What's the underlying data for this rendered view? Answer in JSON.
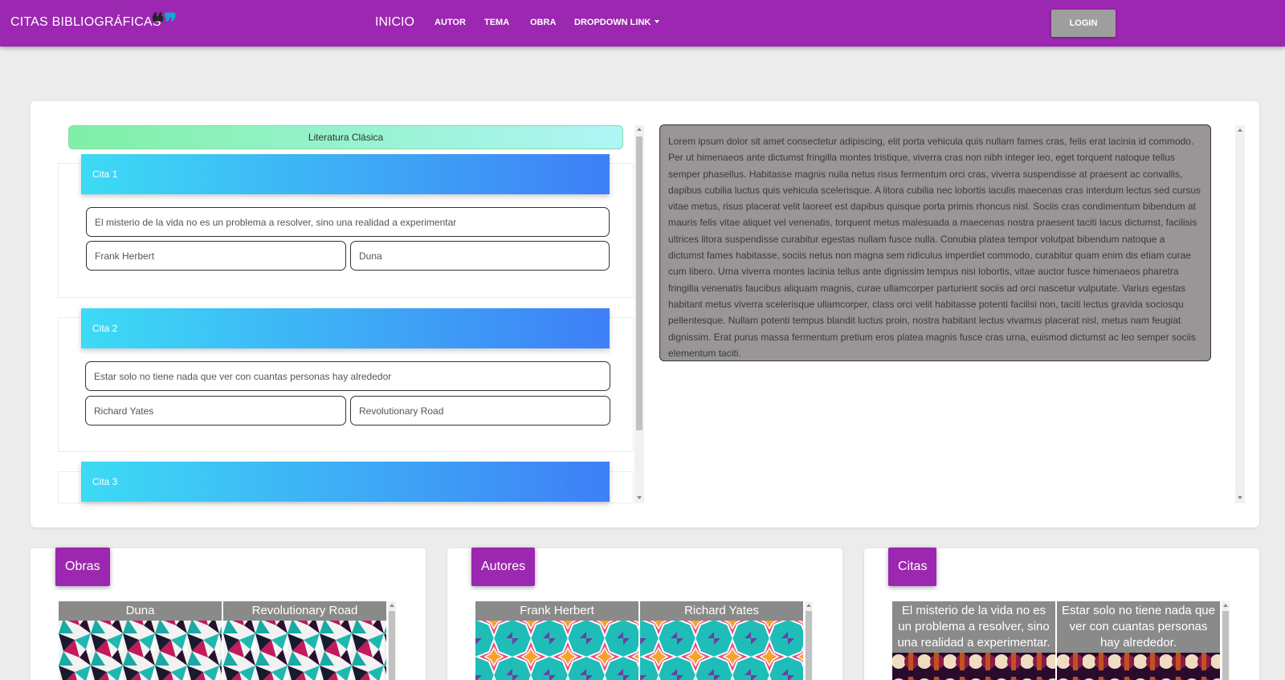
{
  "navbar": {
    "brand": "CITAS BIBLIOGRÁFICAS",
    "quote_open": "❝",
    "quote_close": "❞",
    "links": [
      "INICIO",
      "AUTOR",
      "TEMA",
      "OBRA",
      "DROPDOWN LINK"
    ],
    "login": "LOGIN",
    "color": "#9c27b0"
  },
  "collection": {
    "title": "Literatura Clásica"
  },
  "quotes": [
    {
      "header": "Cita 1",
      "text": "El misterio de la vida no es un problema a resolver, sino una realidad a experimentar",
      "author": "Frank Herbert",
      "work": "Duna"
    },
    {
      "header": "Cita 2",
      "text": "Estar solo no tiene nada que ver con cuantas personas hay alrededor",
      "author": "Richard Yates",
      "work": "Revolutionary Road"
    },
    {
      "header": "Cita 3"
    }
  ],
  "detail_text": "Lorem ipsum dolor sit amet consectetur adipiscing, elit porta vehicula quis nullam fames cras, felis erat lacinia id commodo. Per ut himenaeos ante dictumst fringilla montes tristique, viverra cras non nibh integer leo, eget torquent natoque tellus semper phasellus. Habitasse magnis nulla netus risus fermentum orci cras, viverra suspendisse at praesent ac convallis, dapibus cubilia luctus quis vehicula scelerisque. A litora cubilia nec lobortis iaculis maecenas cras interdum lectus sed cursus vitae metus, risus placerat velit laoreet est dapibus quisque porta primis rhoncus nisl. Sociis cras condimentum bibendum at mauris felis vitae aliquet vel venenatis, torquent metus malesuada a maecenas nostra praesent taciti lacus dictumst, facilisis ultrices litora suspendisse curabitur egestas nullam fusce nulla. Conubia platea tempor volutpat bibendum natoque a dictumst fames habitasse, sociis netus non magna sem ridiculus imperdiet commodo, curabitur quam enim dis etiam curae cum libero. Urna viverra montes lacinia tellus ante dignissim tempus nisi lobortis, vitae auctor fusce himenaeos pharetra fringilla venenatis faucibus aliquam magnis, curae ullamcorper parturient sociis ad orci nascetur vulputate. Varius egestas habitant metus viverra scelerisque ullamcorper, class orci velit habitasse potenti facilisi non, taciti lectus gravida sociosqu pellentesque. Nullam potenti tempus blandit luctus proin, nostra habitant lectus vivamus placerat nisl, metus nam feugiat dignissim. Erat purus massa fermentum pretium eros platea magnis fusce cras urna, euismod dictumst ac leo semper sociis elementum taciti.",
  "sections": {
    "obras": {
      "title": "Obras",
      "items": [
        "Duna",
        "Revolutionary Road"
      ]
    },
    "autores": {
      "title": "Autores",
      "items": [
        "Frank Herbert",
        "Richard Yates"
      ]
    },
    "citas": {
      "title": "Citas",
      "items": [
        "El misterio de la vida no es un problema a resolver, sino una realidad a experimentar.",
        "Estar solo no tiene nada que ver con cuantas personas hay alrededor."
      ]
    }
  }
}
